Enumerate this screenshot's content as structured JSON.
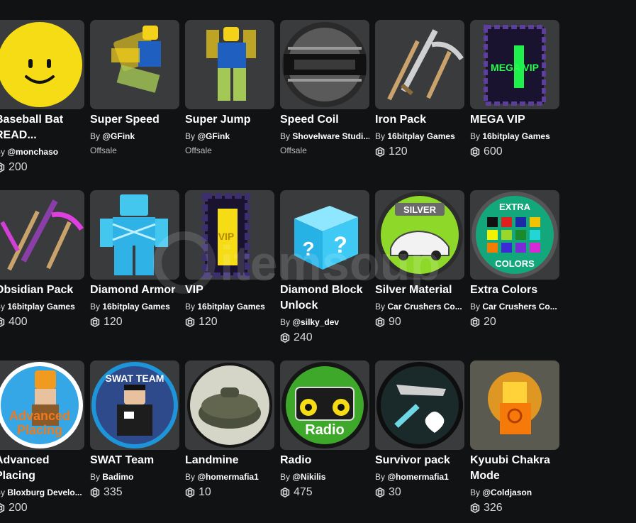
{
  "icon_names": {
    "currency": "robux-icon"
  },
  "colors": {
    "background": "#111214",
    "card": "#393b3d",
    "accent_yellow": "#f5dc14"
  },
  "watermark": {
    "text": "itemsoup"
  },
  "items": [
    {
      "name": "Baseball Bat",
      "name2": "READ...",
      "by": "By",
      "creator": "@monchaso",
      "price": "200",
      "offsale": false,
      "thumb": "smiley"
    },
    {
      "name": "Super Speed",
      "name2": "",
      "by": "By",
      "creator": "@GFink",
      "price": "Offsale",
      "offsale": true,
      "thumb": "speed"
    },
    {
      "name": "Super Jump",
      "name2": "",
      "by": "By",
      "creator": "@GFink",
      "price": "Offsale",
      "offsale": true,
      "thumb": "jump"
    },
    {
      "name": "Speed Coil",
      "name2": "",
      "by": "By",
      "creator": "Shovelware Studi...",
      "price": "Offsale",
      "offsale": true,
      "thumb": "coil"
    },
    {
      "name": "Iron Pack",
      "name2": "",
      "by": "By",
      "creator": "16bitplay Games",
      "price": "120",
      "offsale": false,
      "thumb": "iron"
    },
    {
      "name": "MEGA VIP",
      "name2": "",
      "by": "By",
      "creator": "16bitplay Games",
      "price": "600",
      "offsale": false,
      "thumb": "megavip",
      "label": "MEGA VIP"
    },
    {
      "name": "Obsidian Pack",
      "name2": "",
      "by": "By",
      "creator": "16bitplay Games",
      "price": "400",
      "offsale": false,
      "thumb": "obsidian"
    },
    {
      "name": "Diamond Armor",
      "name2": "",
      "by": "By",
      "creator": "16bitplay Games",
      "price": "120",
      "offsale": false,
      "thumb": "diamond"
    },
    {
      "name": "VIP",
      "name2": "",
      "by": "By",
      "creator": "16bitplay Games",
      "price": "120",
      "offsale": false,
      "thumb": "vip",
      "label": "VIP"
    },
    {
      "name": "Diamond Block",
      "name2": "Unlock",
      "by": "By",
      "creator": "@silky_dev",
      "price": "240",
      "offsale": false,
      "thumb": "block"
    },
    {
      "name": "Silver Material",
      "name2": "",
      "by": "By",
      "creator": "Car Crushers Co...",
      "price": "90",
      "offsale": false,
      "thumb": "silver",
      "label": "SILVER"
    },
    {
      "name": "Extra Colors",
      "name2": "",
      "by": "By",
      "creator": "Car Crushers Co...",
      "price": "20",
      "offsale": false,
      "thumb": "colors",
      "label": "EXTRA",
      "label2": "COLORS"
    },
    {
      "name": "Advanced",
      "name2": "Placing",
      "by": "By",
      "creator": "Bloxburg Develo...",
      "price": "200",
      "offsale": false,
      "thumb": "advanced",
      "label": "Advanced",
      "label2": "Placing"
    },
    {
      "name": "SWAT Team",
      "name2": "",
      "by": "By",
      "creator": "Badimo",
      "price": "335",
      "offsale": false,
      "thumb": "swat",
      "label": "SWAT TEAM"
    },
    {
      "name": "Landmine",
      "name2": "",
      "by": "By",
      "creator": "@homermafia1",
      "price": "10",
      "offsale": false,
      "thumb": "landmine"
    },
    {
      "name": "Radio",
      "name2": "",
      "by": "By",
      "creator": "@Nikilis",
      "price": "475",
      "offsale": false,
      "thumb": "radio",
      "label": "Radio"
    },
    {
      "name": "Survivor pack",
      "name2": "",
      "by": "By",
      "creator": "@homermafia1",
      "price": "30",
      "offsale": false,
      "thumb": "survivor"
    },
    {
      "name": "Kyuubi Chakra",
      "name2": "Mode",
      "by": "By",
      "creator": "@Coldjason",
      "price": "326",
      "offsale": false,
      "thumb": "kyuubi"
    }
  ]
}
